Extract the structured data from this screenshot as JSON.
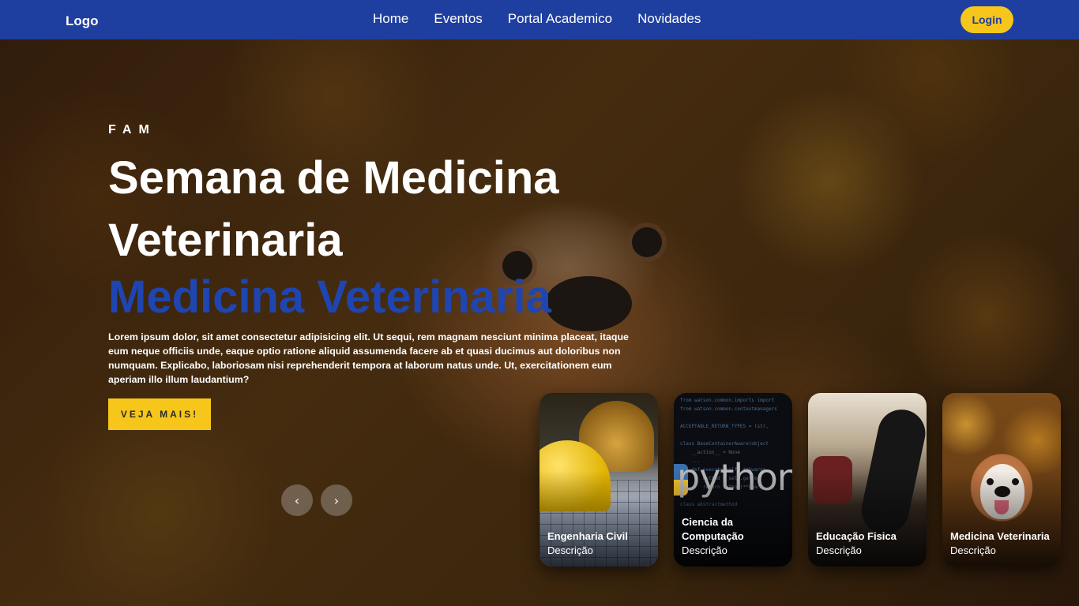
{
  "navbar": {
    "logo": "Logo",
    "links": [
      "Home",
      "Eventos",
      "Portal Academico",
      "Novidades"
    ],
    "login_label": "Login"
  },
  "hero": {
    "kicker": "FAM",
    "title": "Semana de Medicina Veterinaria",
    "subtitle": "Medicina Veterinaria",
    "description": "Lorem ipsum dolor, sit amet consectetur adipisicing elit. Ut sequi, rem magnam nesciunt minima placeat, itaque eum neque officiis unde, eaque optio ratione aliquid assumenda facere ab et quasi ducimus aut doloribus non numquam. Explicabo, laboriosam nisi reprehenderit tempora at laborum natus unde. Ut, exercitationem eum aperiam illo illum laudantium?",
    "cta_label": "VEJA MAIS!"
  },
  "carousel": {
    "prev_label": "‹",
    "next_label": "›"
  },
  "cards": [
    {
      "title": "Engenharia Civil",
      "desc": "Descrição"
    },
    {
      "title": "Ciencia da Computação",
      "desc": "Descrição"
    },
    {
      "title": "Educação Fisica",
      "desc": "Descrição"
    },
    {
      "title": "Medicina Veterinaria",
      "desc": "Descrição"
    }
  ],
  "colors": {
    "navbar": "#1f3fa0",
    "accent_yellow": "#f7c61a",
    "subtitle_blue": "#1f45b0"
  }
}
